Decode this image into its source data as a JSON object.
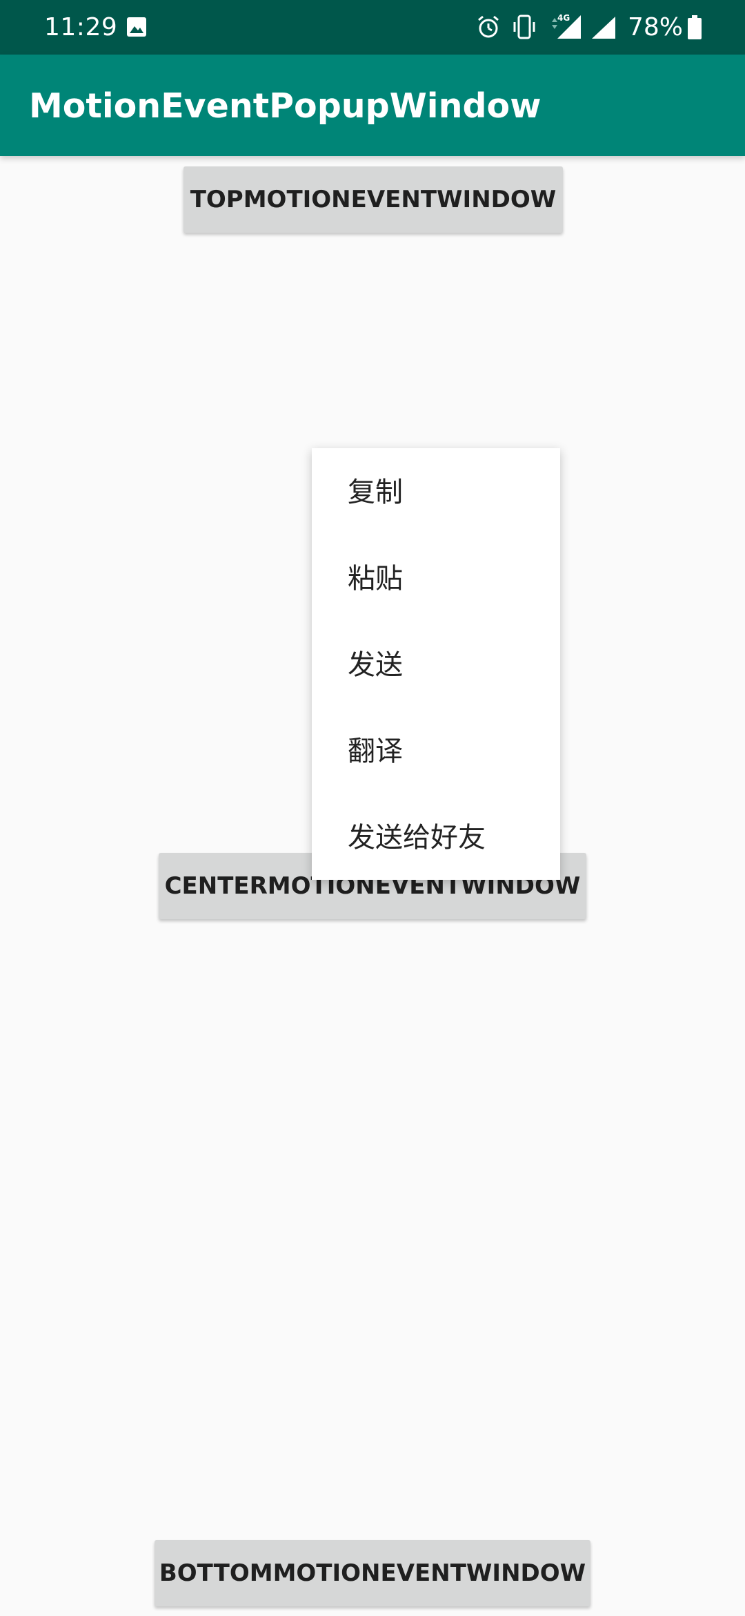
{
  "status_bar": {
    "time": "11:29",
    "battery_percent": "78%",
    "network_label": "4G",
    "icons": [
      "image-icon",
      "alarm-icon",
      "vibrate-icon",
      "signal-4g-icon",
      "signal-icon",
      "battery-icon"
    ],
    "background_color": "#00574b"
  },
  "app_bar": {
    "title": "MotionEventPopupWindow",
    "background_color": "#008577"
  },
  "buttons": {
    "top": "TOPMOTIONEVENTWINDOW",
    "center": "CENTERMOTIONEVENTWINDOW",
    "bottom": "BOTTOMMOTIONEVENTWINDOW"
  },
  "popup_menu": {
    "items": [
      {
        "label": "复制"
      },
      {
        "label": "粘贴"
      },
      {
        "label": "发送"
      },
      {
        "label": "翻译"
      },
      {
        "label": "发送给好友"
      }
    ]
  }
}
